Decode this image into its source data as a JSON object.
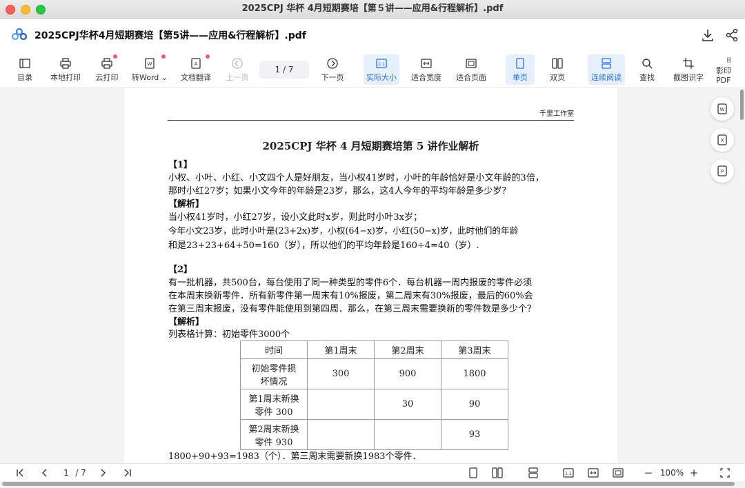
{
  "window": {
    "title": "2025CPJ 华杯 4月短期赛培【第５讲——应用&行程解析】.pdf"
  },
  "header": {
    "doc_title": "2025CPJ华杯4月短期赛培【第5讲——应用&行程解析】.pdf"
  },
  "toolbar": {
    "items": [
      {
        "label": "目录",
        "icon": "toc-icon"
      },
      {
        "label": "本地打印",
        "icon": "printer-icon"
      },
      {
        "label": "云打印",
        "icon": "cloud-print-icon"
      },
      {
        "label": "转Word",
        "icon": "word-icon"
      },
      {
        "label": "文档翻译",
        "icon": "translate-icon"
      },
      {
        "label": "上一页",
        "icon": "prev-page-icon"
      },
      {
        "label": "下一页",
        "icon": "next-page-icon"
      },
      {
        "label": "实际大小",
        "icon": "actual-size-icon"
      },
      {
        "label": "适合宽度",
        "icon": "fit-width-icon"
      },
      {
        "label": "适合页面",
        "icon": "fit-page-icon"
      },
      {
        "label": "单页",
        "icon": "single-page-icon"
      },
      {
        "label": "双页",
        "icon": "double-page-icon"
      },
      {
        "label": "连续阅读",
        "icon": "continuous-icon"
      },
      {
        "label": "查找",
        "icon": "search-icon"
      },
      {
        "label": "截图识字",
        "icon": "crop-ocr-icon"
      },
      {
        "label": "影印PDF",
        "icon": "scan-pdf-icon"
      }
    ],
    "page_display": "1  / 7",
    "word_chevron": "⌄"
  },
  "document": {
    "header_right": "千里工作室",
    "title": "2025CPJ 华杯 4 月短期赛培第 5 讲作业解析",
    "q1": {
      "num": "【1】",
      "l1": "小权、小叶、小红、小文四个人是好朋友，当小权41岁时，小叶的年龄恰好是小文年龄的3倍，",
      "l2": "那时小红27岁；如果小文今年的年龄是23岁，那么，这4人今年的平均年龄是多少岁？",
      "sol": "【解析】",
      "s1": "当小权41岁时，小红27岁，设小文此时x岁，则此时小叶3x岁；",
      "s2": "今年小文23岁，此时小叶是(23+2x)岁，小权(64−x)岁，小红(50−x)岁，此时他们的年龄",
      "s3": "和是23+23+64+50=160（岁），所以他们的平均年龄是160÷4=40（岁）."
    },
    "q2": {
      "num": "【2】",
      "l1": "有一批机器，共500台，每台使用了同一种类型的零件6个．每台机器一周内报废的零件必须",
      "l2": "在本周末换新零件．所有新零件第一周末有10%报废，第二周末有30%报废，最后的60%会",
      "l3": "在第三周末报废，没有零件能使用到第四周．那么，在第三周末需要换新的零件数是多少个？",
      "sol": "【解析】",
      "s1": "列表格计算：初始零件3000个",
      "table": {
        "headers": [
          "时间",
          "第1周末",
          "第2周末",
          "第3周末"
        ],
        "rows": [
          {
            "label1": "初始零件损",
            "label2": "坏情况",
            "cells": [
              "300",
              "900",
              "1800"
            ]
          },
          {
            "label1": "第1周末新换",
            "label2": "零件  300",
            "cells": [
              "",
              "30",
              "90"
            ]
          },
          {
            "label1": "第2周末新换",
            "label2": "零件  930",
            "cells": [
              "",
              "",
              "93"
            ]
          }
        ]
      },
      "s2": "1800+90+93=1983（个）．第三周末需要新换1983个零件．"
    }
  },
  "bottombar": {
    "page": "1",
    "total": "/ 7",
    "zoom": "100%",
    "minus": "−",
    "plus": "+"
  }
}
